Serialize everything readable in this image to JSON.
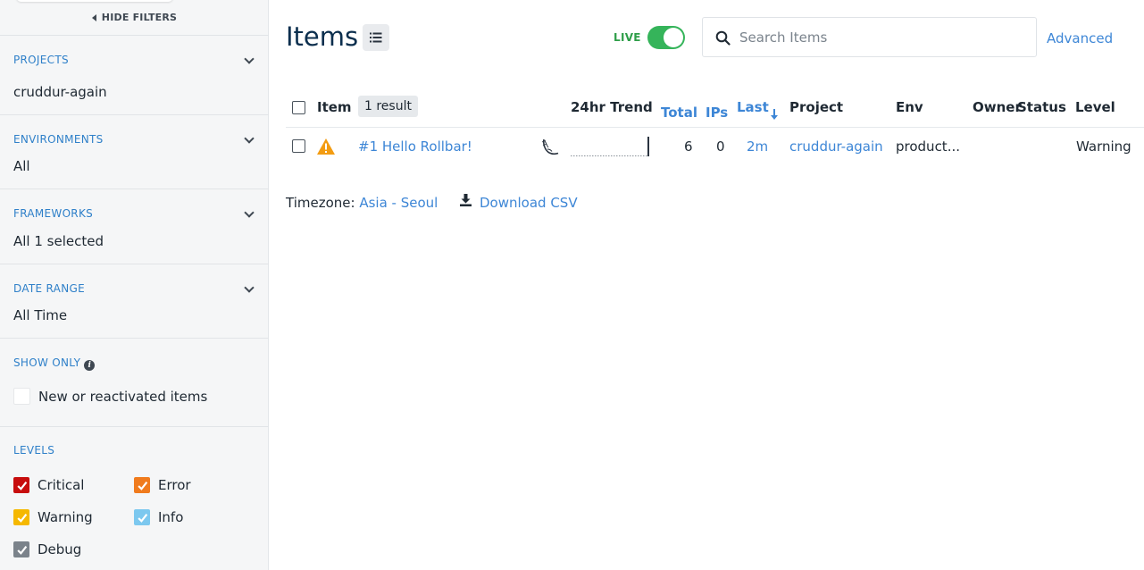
{
  "sidebar": {
    "hide_filters_label": "HIDE FILTERS",
    "sections": {
      "projects": {
        "title": "PROJECTS",
        "value": "cruddur-again"
      },
      "environments": {
        "title": "ENVIRONMENTS",
        "value": "All"
      },
      "frameworks": {
        "title": "FRAMEWORKS",
        "value": "All 1 selected"
      },
      "date_range": {
        "title": "DATE RANGE",
        "value": "All Time"
      },
      "show_only": {
        "title": "SHOW ONLY",
        "option_label": "New or reactivated items",
        "checked": false
      },
      "levels": {
        "title": "LEVELS",
        "items": [
          {
            "label": "Critical",
            "color": "#c70d0d",
            "checked": true
          },
          {
            "label": "Error",
            "color": "#f07b1d",
            "checked": true
          },
          {
            "label": "Warning",
            "color": "#f5b800",
            "checked": true
          },
          {
            "label": "Info",
            "color": "#7cc8ef",
            "checked": true
          },
          {
            "label": "Debug",
            "color": "#7b838b",
            "checked": true
          }
        ]
      }
    }
  },
  "header": {
    "title": "Items",
    "live_label": "LIVE",
    "live_on": true,
    "search_placeholder": "Search Items",
    "advanced_label": "Advanced"
  },
  "table": {
    "columns": {
      "item": "Item",
      "result_count": "1 result",
      "trend": "24hr Trend",
      "total": "Total",
      "ips": "IPs",
      "last": "Last",
      "project": "Project",
      "env": "Env",
      "owner": "Owner",
      "status": "Status",
      "level": "Level"
    },
    "rows": [
      {
        "title": "#1 Hello Rollbar!",
        "level_icon": "warning-triangle-icon",
        "framework_icon": "flask-icon",
        "total": "6",
        "ips": "0",
        "last": "2m",
        "project": "cruddur-again",
        "env": "product...",
        "owner": "",
        "status": "",
        "level": "Warning"
      }
    ]
  },
  "footer": {
    "timezone_label": "Timezone:",
    "timezone_value": "Asia - Seoul",
    "download_label": "Download CSV"
  },
  "colors": {
    "accent_link": "#3d86d6",
    "filter_title": "#2f80c9",
    "live_green": "#35b45a",
    "title_navy": "#0c2f4e",
    "warning_orange": "#f39c12"
  }
}
